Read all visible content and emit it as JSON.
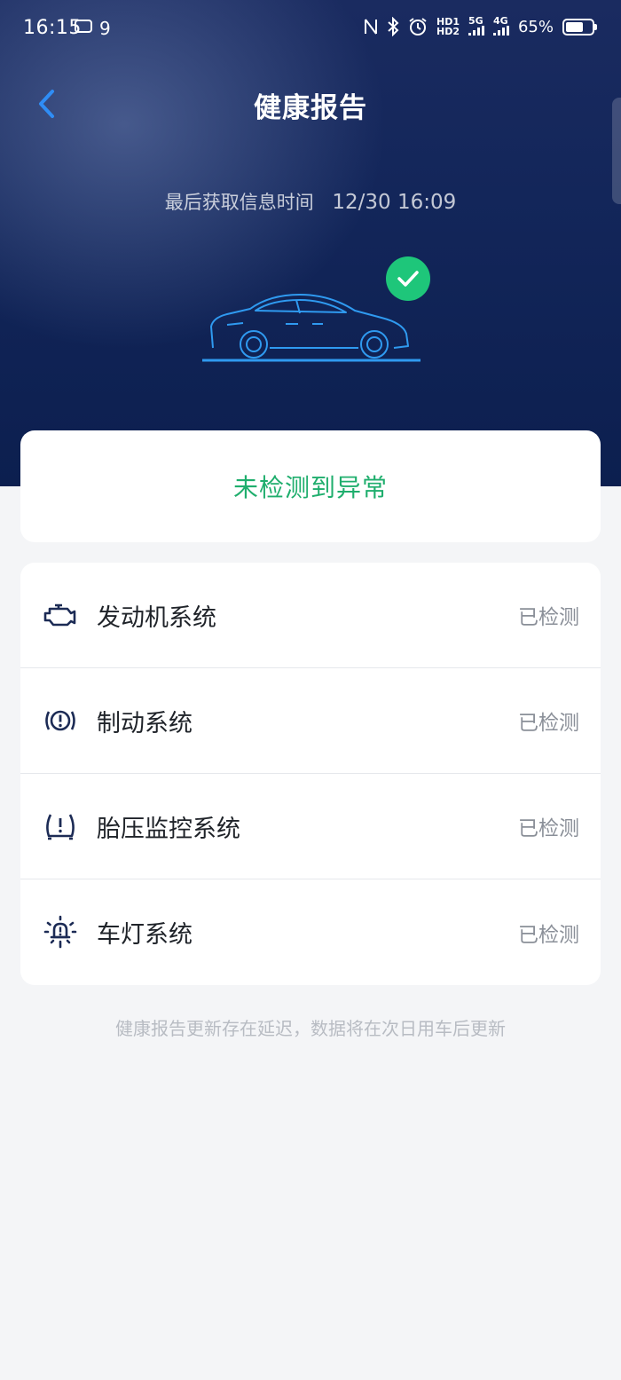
{
  "status_bar": {
    "time": "16:15",
    "notification_count": "9",
    "hd1": "HD1",
    "hd2": "HD2",
    "net_5g": "5G",
    "net_4g": "4G",
    "battery_percent": "65%",
    "battery_level": 0.65
  },
  "header": {
    "title": "健康报告",
    "back_icon": "chevron-left-icon"
  },
  "summary": {
    "last_update_label": "最后获取信息时间",
    "last_update_time": "12/30 16:09",
    "status_icon": "check-circle-icon",
    "result_text": "未检测到异常"
  },
  "systems": [
    {
      "icon": "engine-icon",
      "name": "发动机系统",
      "status": "已检测"
    },
    {
      "icon": "brake-warning-icon",
      "name": "制动系统",
      "status": "已检测"
    },
    {
      "icon": "tire-pressure-icon",
      "name": "胎压监控系统",
      "status": "已检测"
    },
    {
      "icon": "light-bulb-icon",
      "name": "车灯系统",
      "status": "已检测"
    }
  ],
  "footer_note": "健康报告更新存在延迟，数据将在次日用车后更新",
  "colors": {
    "accent_blue": "#2f8df5",
    "success_green": "#1fae6d",
    "header_dark": "#0c1f4f",
    "icon_dark": "#1c2b55"
  }
}
